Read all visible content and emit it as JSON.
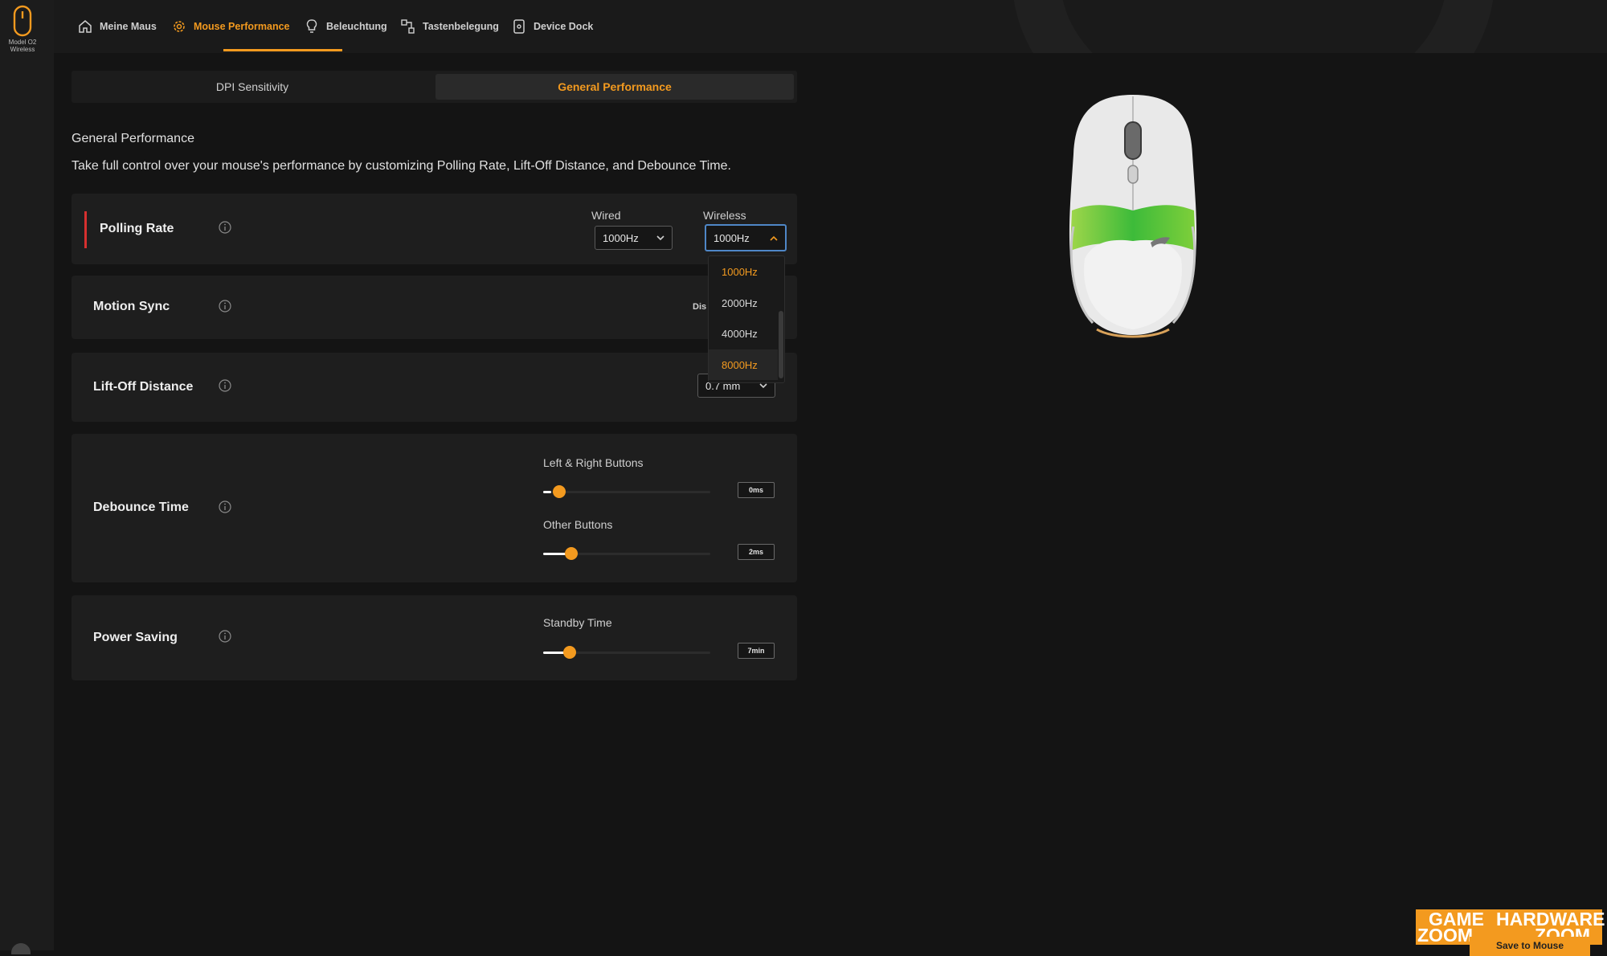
{
  "device": {
    "name_line1": "Model O2",
    "name_line2": "Wireless"
  },
  "nav": {
    "items": [
      {
        "label": "Meine Maus",
        "icon": "home-icon"
      },
      {
        "label": "Mouse Performance",
        "icon": "gear-icon"
      },
      {
        "label": "Beleuchtung",
        "icon": "lightbulb-icon"
      },
      {
        "label": "Tastenbelegung",
        "icon": "key-mapping-icon"
      },
      {
        "label": "Device Dock",
        "icon": "dock-icon"
      }
    ],
    "active": "Mouse Performance"
  },
  "subtabs": [
    "DPI Sensitivity",
    "General Performance"
  ],
  "section": {
    "title": "General Performance",
    "description": "Take full control over your mouse's performance by customizing Polling Rate, Lift-Off Distance, and Debounce Time."
  },
  "polling_rate": {
    "title": "Polling Rate",
    "wired_label": "Wired",
    "wired_value": "1000Hz",
    "wireless_label": "Wireless",
    "wireless_value": "1000Hz",
    "options": [
      "1000Hz",
      "2000Hz",
      "4000Hz",
      "8000Hz"
    ]
  },
  "motion_sync": {
    "title": "Motion Sync",
    "value_partial": "Dis"
  },
  "lift_off": {
    "title": "Lift-Off Distance",
    "value": "0.7 mm"
  },
  "debounce": {
    "title": "Debounce Time",
    "left_right_label": "Left & Right Buttons",
    "left_right_value": "0ms",
    "left_right_level": 0.05,
    "other_label": "Other Buttons",
    "other_value": "2ms",
    "other_level": 0.17
  },
  "power_saving": {
    "title": "Power Saving",
    "standby_label": "Standby Time",
    "standby_value": "7min",
    "standby_level": 0.16
  },
  "watermark": {
    "game": "GAME",
    "zoom1": "ZOOM",
    "hardware": "HARDWARE",
    "zoom2": "ZOOM"
  },
  "save_button": "Save to Mouse",
  "colors": {
    "accent": "#f39a1f",
    "alert": "#d6302f",
    "focus": "#4f87c7",
    "background": "#141414"
  }
}
